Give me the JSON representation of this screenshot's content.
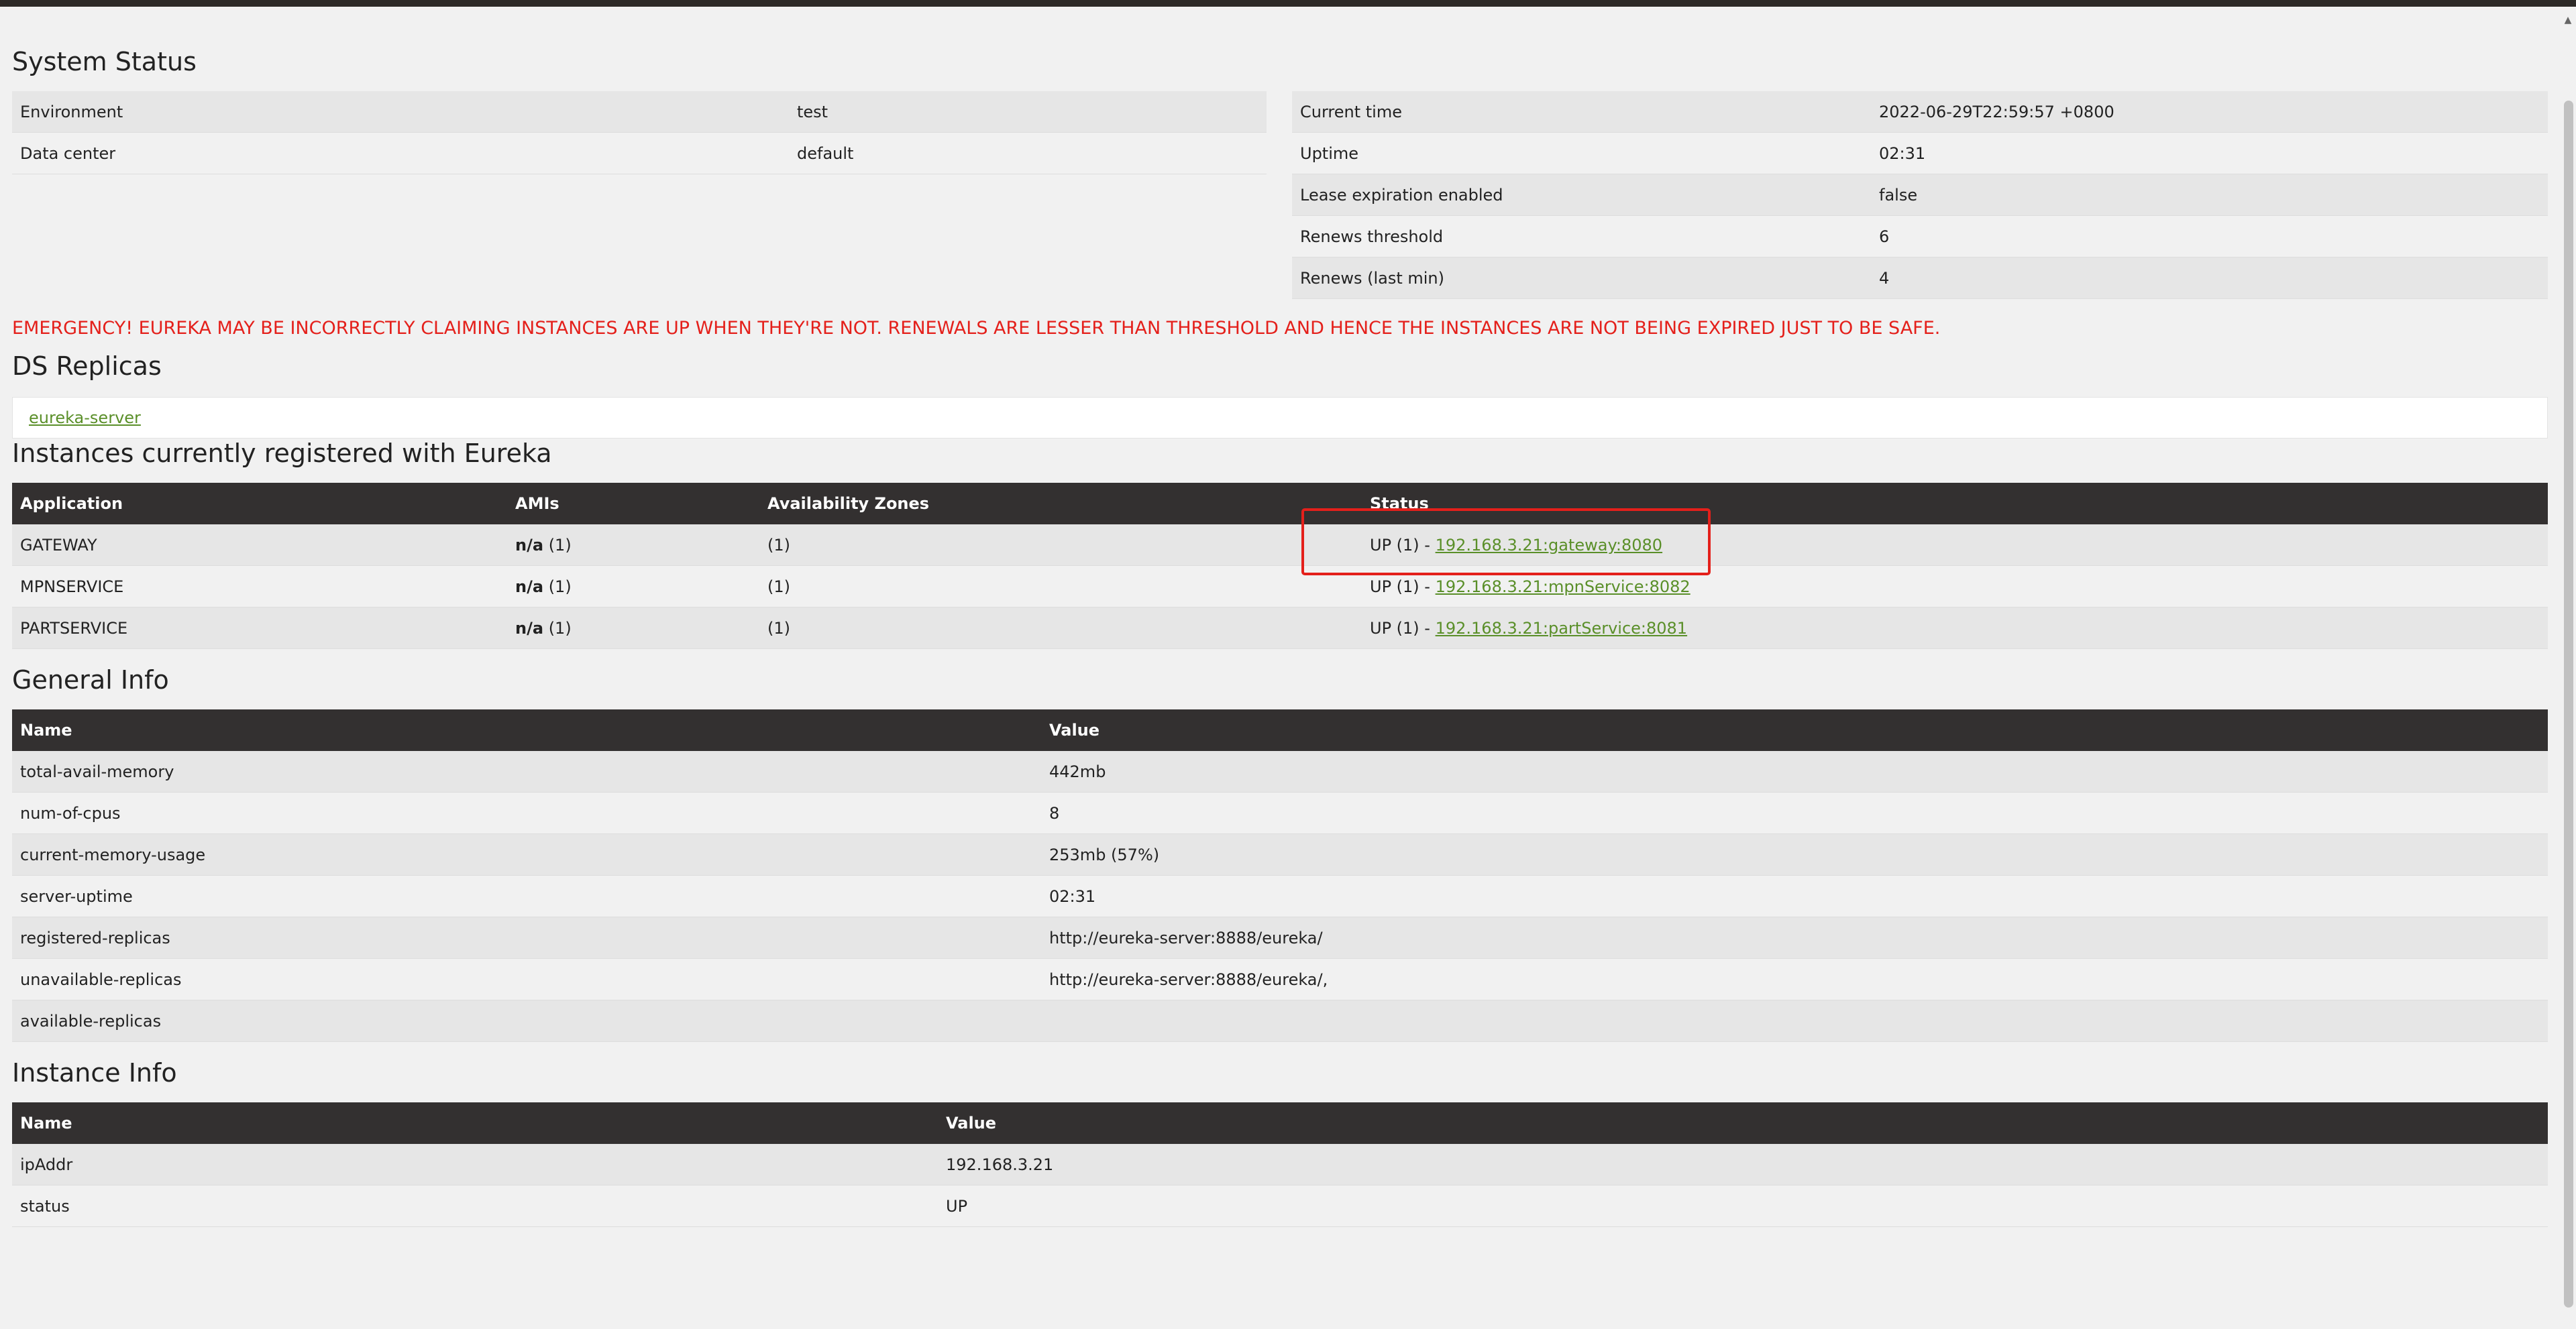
{
  "system_status": {
    "title": "System Status",
    "left": [
      {
        "name": "Environment",
        "value": "test"
      },
      {
        "name": "Data center",
        "value": "default"
      }
    ],
    "right": [
      {
        "name": "Current time",
        "value": "2022-06-29T22:59:57 +0800"
      },
      {
        "name": "Uptime",
        "value": "02:31"
      },
      {
        "name": "Lease expiration enabled",
        "value": "false"
      },
      {
        "name": "Renews threshold",
        "value": "6"
      },
      {
        "name": "Renews (last min)",
        "value": "4"
      }
    ]
  },
  "emergency": "EMERGENCY! EUREKA MAY BE INCORRECTLY CLAIMING INSTANCES ARE UP WHEN THEY'RE NOT. RENEWALS ARE LESSER THAN THRESHOLD AND HENCE THE INSTANCES ARE NOT BEING EXPIRED JUST TO BE SAFE.",
  "ds_replicas": {
    "title": "DS Replicas",
    "link": "eureka-server"
  },
  "instances": {
    "title": "Instances currently registered with Eureka",
    "headers": [
      "Application",
      "AMIs",
      "Availability Zones",
      "Status"
    ],
    "rows": [
      {
        "app": "GATEWAY",
        "amis_label": "n/a",
        "amis_count": "(1)",
        "zones": "(1)",
        "status_prefix": "UP (1) - ",
        "status_link": "192.168.3.21:gateway:8080"
      },
      {
        "app": "MPNSERVICE",
        "amis_label": "n/a",
        "amis_count": "(1)",
        "zones": "(1)",
        "status_prefix": "UP (1) - ",
        "status_link": "192.168.3.21:mpnService:8082"
      },
      {
        "app": "PARTSERVICE",
        "amis_label": "n/a",
        "amis_count": "(1)",
        "zones": "(1)",
        "status_prefix": "UP (1) - ",
        "status_link": "192.168.3.21:partService:8081"
      }
    ]
  },
  "general_info": {
    "title": "General Info",
    "headers": [
      "Name",
      "Value"
    ],
    "rows": [
      {
        "name": "total-avail-memory",
        "value": "442mb"
      },
      {
        "name": "num-of-cpus",
        "value": "8"
      },
      {
        "name": "current-memory-usage",
        "value": "253mb (57%)"
      },
      {
        "name": "server-uptime",
        "value": "02:31"
      },
      {
        "name": "registered-replicas",
        "value": "http://eureka-server:8888/eureka/"
      },
      {
        "name": "unavailable-replicas",
        "value": "http://eureka-server:8888/eureka/,"
      },
      {
        "name": "available-replicas",
        "value": ""
      }
    ]
  },
  "instance_info": {
    "title": "Instance Info",
    "headers": [
      "Name",
      "Value"
    ],
    "rows": [
      {
        "name": "ipAddr",
        "value": "192.168.3.21"
      },
      {
        "name": "status",
        "value": "UP"
      }
    ]
  },
  "colors": {
    "header_bg": "#333030",
    "link": "#5a8f29",
    "emergency": "#e4201b",
    "highlight": "#e4201b"
  }
}
